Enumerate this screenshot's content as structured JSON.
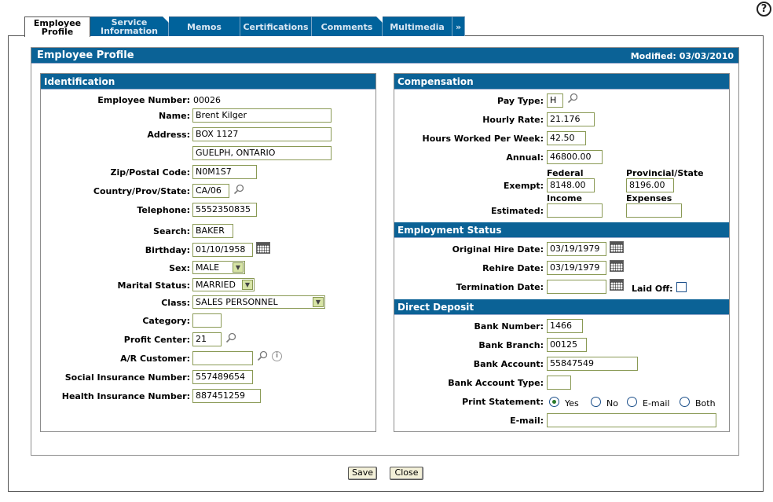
{
  "help": {
    "symbol": "?"
  },
  "tabs": [
    {
      "line1": "Employee",
      "line2": "Profile"
    },
    {
      "line1": "Service",
      "line2": "Information"
    },
    {
      "line1": "Memos",
      "line2": ""
    },
    {
      "line1": "Certifications",
      "line2": ""
    },
    {
      "line1": "Comments",
      "line2": ""
    },
    {
      "line1": "Multimedia",
      "line2": ""
    },
    {
      "line1": "»",
      "line2": ""
    }
  ],
  "header": {
    "title": "Employee Profile",
    "modified_label": "Modified:",
    "modified_date": "03/03/2010"
  },
  "identification": {
    "title": "Identification",
    "employee_number_label": "Employee Number:",
    "employee_number": "00026",
    "name_label": "Name:",
    "name": "Brent Kilger",
    "address_label": "Address:",
    "address1": "BOX 1127",
    "address2": "GUELPH, ONTARIO",
    "zip_label": "Zip/Postal Code:",
    "zip": "N0M1S7",
    "country_label": "Country/Prov/State:",
    "country": "CA/06",
    "telephone_label": "Telephone:",
    "telephone": "5552350835",
    "search_label": "Search:",
    "search": "BAKER",
    "birthday_label": "Birthday:",
    "birthday": "01/10/1958",
    "sex_label": "Sex:",
    "sex": "MALE",
    "marital_label": "Marital Status:",
    "marital": "MARRIED",
    "class_label": "Class:",
    "class": "SALES PERSONNEL",
    "category_label": "Category:",
    "category": "",
    "profit_center_label": "Profit Center:",
    "profit_center": "21",
    "ar_customer_label": "A/R Customer:",
    "ar_customer": "",
    "sin_label": "Social Insurance Number:",
    "sin": "557489654",
    "hin_label": "Health Insurance Number:",
    "hin": "887451259"
  },
  "compensation": {
    "title": "Compensation",
    "pay_type_label": "Pay Type:",
    "pay_type": "H",
    "hourly_rate_label": "Hourly Rate:",
    "hourly_rate": "21.176",
    "hours_label": "Hours Worked Per Week:",
    "hours": "42.50",
    "annual_label": "Annual:",
    "annual": "46800.00",
    "federal_header": "Federal",
    "provincial_header": "Provincial/State",
    "exempt_label": "Exempt:",
    "exempt_federal": "8148.00",
    "exempt_provincial": "8196.00",
    "income_header": "Income",
    "expenses_header": "Expenses",
    "estimated_label": "Estimated:",
    "estimated_income": "",
    "estimated_expenses": ""
  },
  "employment": {
    "title": "Employment Status",
    "hire_label": "Original Hire Date:",
    "hire": "03/19/1979",
    "rehire_label": "Rehire Date:",
    "rehire": "03/19/1979",
    "termination_label": "Termination Date:",
    "termination": "",
    "laid_off_label": "Laid Off:"
  },
  "direct_deposit": {
    "title": "Direct Deposit",
    "bank_number_label": "Bank Number:",
    "bank_number": "1466",
    "bank_branch_label": "Bank Branch:",
    "bank_branch": "00125",
    "bank_account_label": "Bank Account:",
    "bank_account": "55847549",
    "bank_account_type_label": "Bank Account Type:",
    "bank_account_type": "",
    "print_statement_label": "Print Statement:",
    "options": [
      "Yes",
      "No",
      "E-mail",
      "Both"
    ],
    "selected": "Yes",
    "email_label": "E-mail:",
    "email": ""
  },
  "buttons": {
    "save": "Save",
    "close": "Close"
  }
}
